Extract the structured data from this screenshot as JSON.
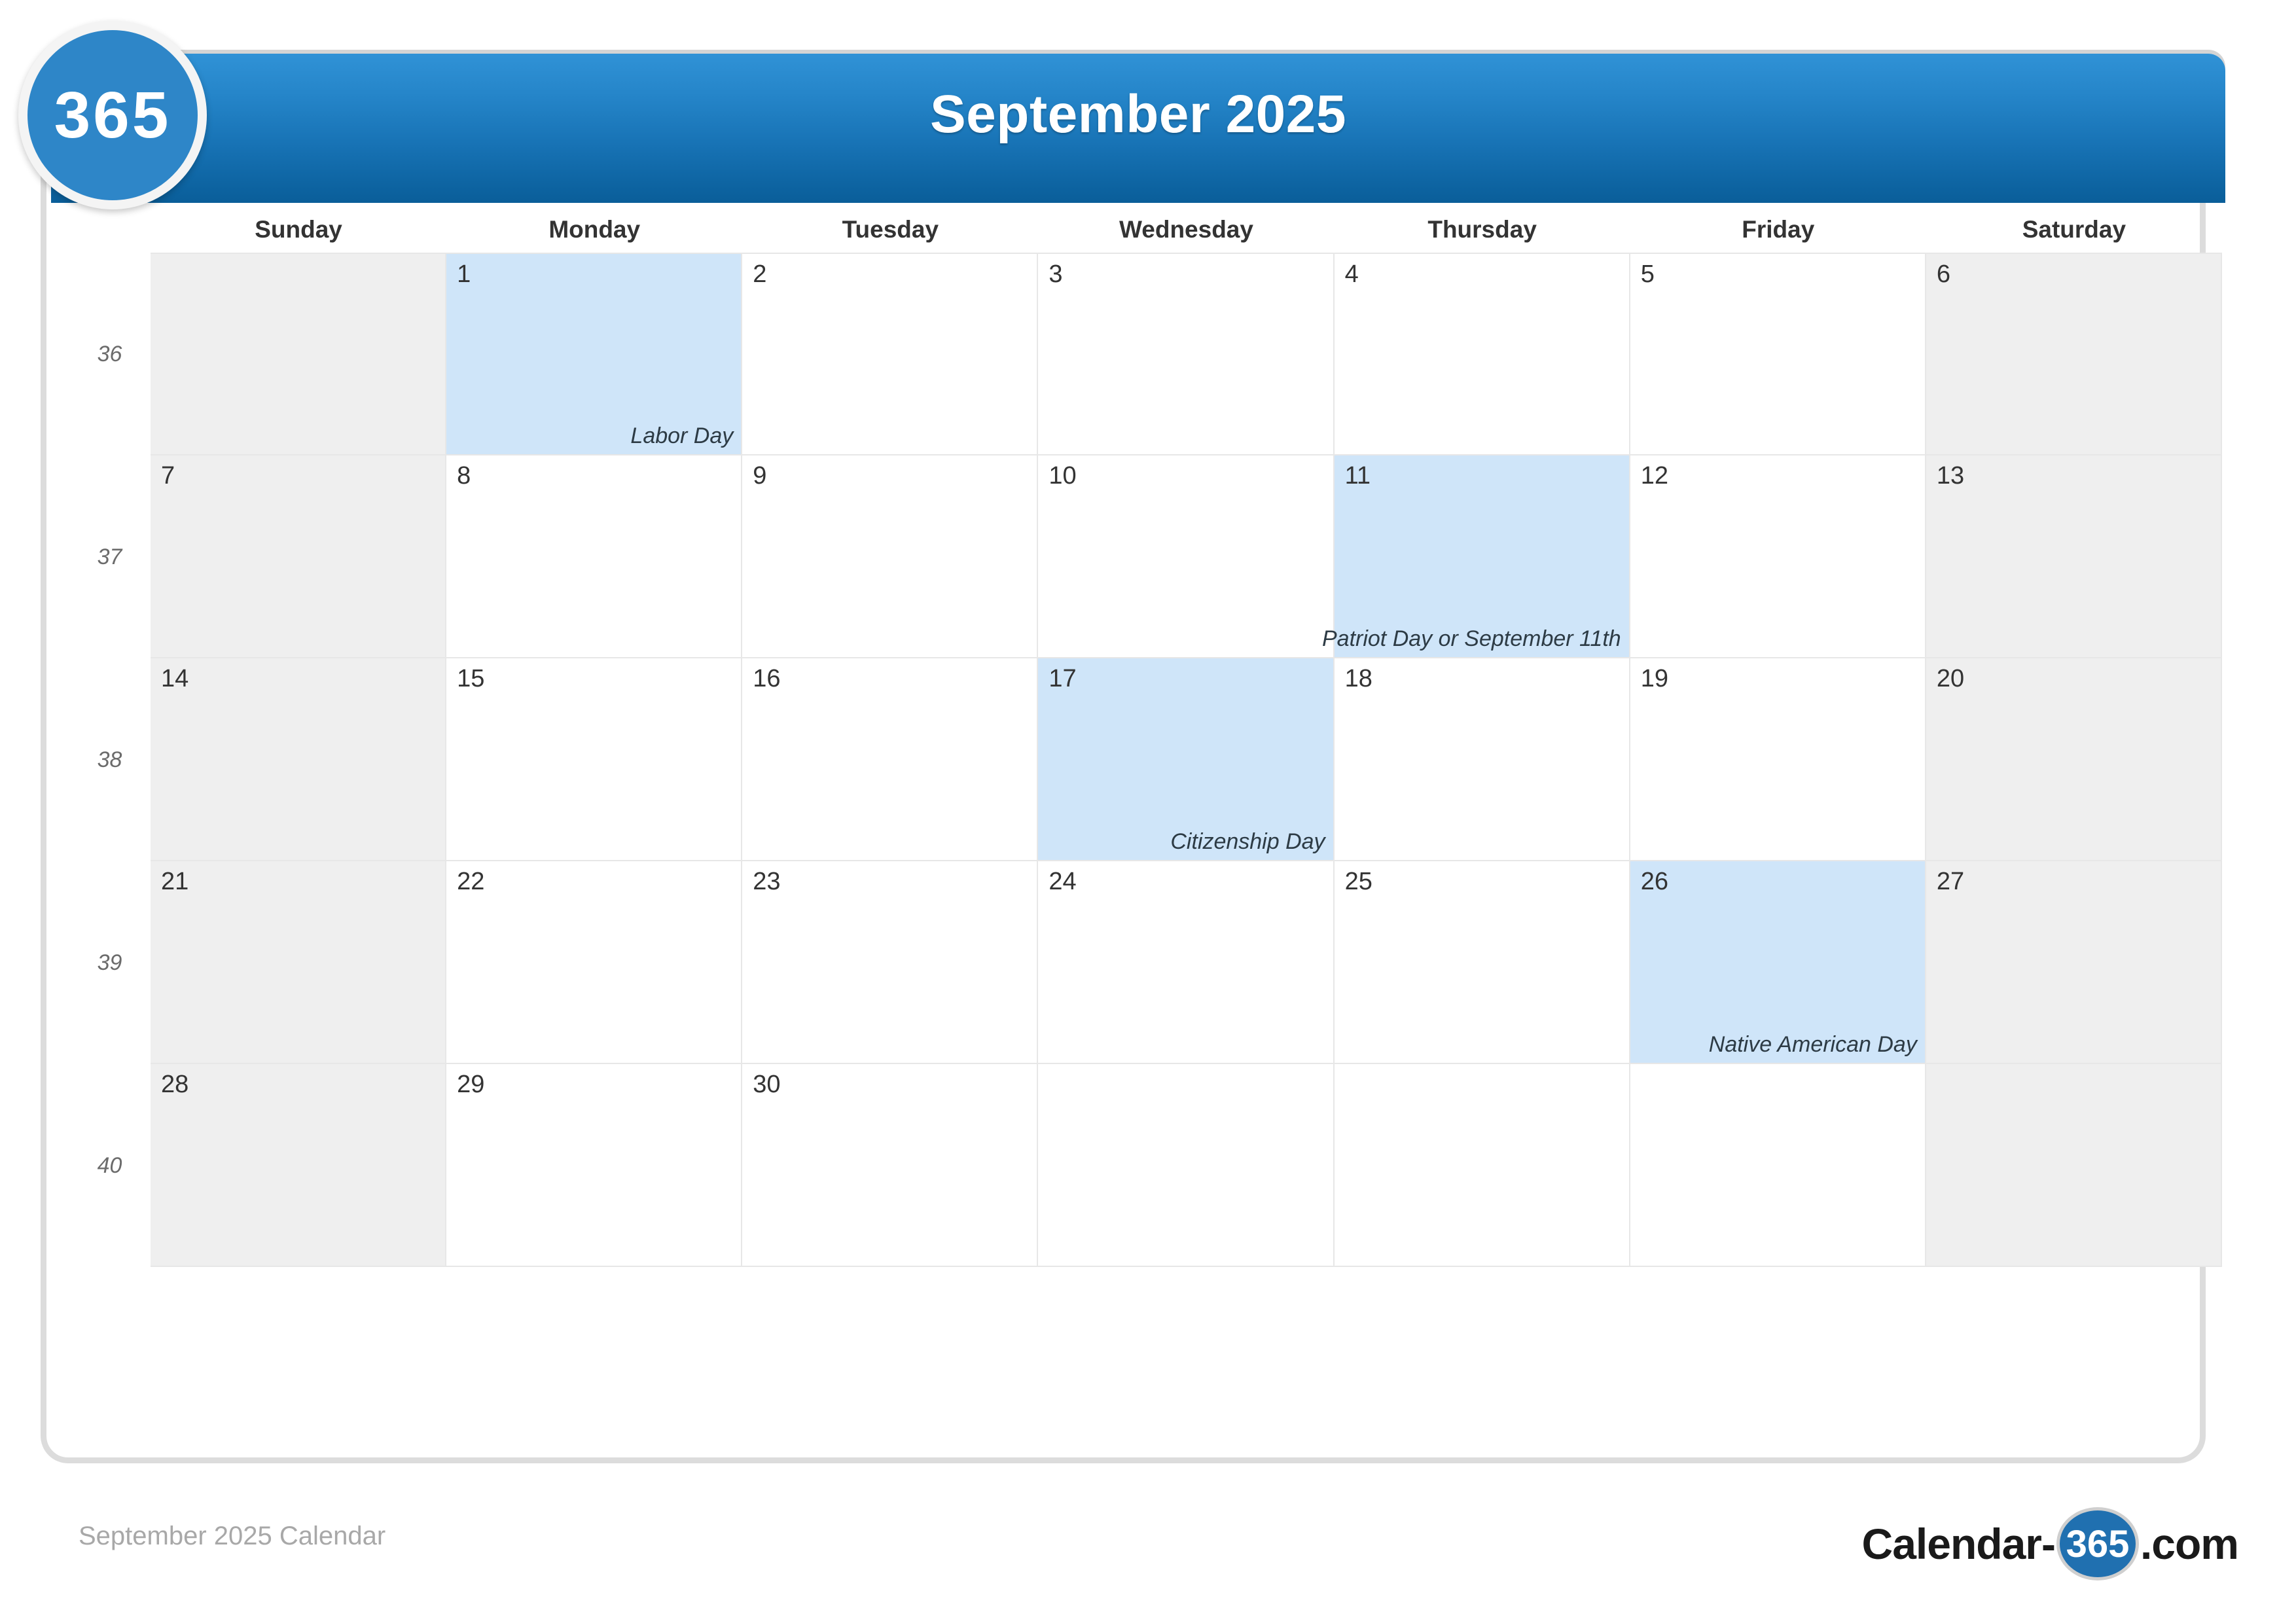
{
  "badge": {
    "label": "365"
  },
  "header": {
    "title": "September 2025"
  },
  "weekday_headers": [
    "Sunday",
    "Monday",
    "Tuesday",
    "Wednesday",
    "Thursday",
    "Friday",
    "Saturday"
  ],
  "watermark": {
    "text": "365"
  },
  "weeks": [
    {
      "week_number": "36",
      "days": [
        {
          "number": "",
          "event": "",
          "weekend": true,
          "holiday": false
        },
        {
          "number": "1",
          "event": "Labor Day",
          "weekend": false,
          "holiday": true
        },
        {
          "number": "2",
          "event": "",
          "weekend": false,
          "holiday": false
        },
        {
          "number": "3",
          "event": "",
          "weekend": false,
          "holiday": false
        },
        {
          "number": "4",
          "event": "",
          "weekend": false,
          "holiday": false
        },
        {
          "number": "5",
          "event": "",
          "weekend": false,
          "holiday": false
        },
        {
          "number": "6",
          "event": "",
          "weekend": true,
          "holiday": false
        }
      ]
    },
    {
      "week_number": "37",
      "days": [
        {
          "number": "7",
          "event": "",
          "weekend": true,
          "holiday": false
        },
        {
          "number": "8",
          "event": "",
          "weekend": false,
          "holiday": false
        },
        {
          "number": "9",
          "event": "",
          "weekend": false,
          "holiday": false
        },
        {
          "number": "10",
          "event": "",
          "weekend": false,
          "holiday": false
        },
        {
          "number": "11",
          "event": "Patriot Day or September 11th",
          "weekend": false,
          "holiday": true
        },
        {
          "number": "12",
          "event": "",
          "weekend": false,
          "holiday": false
        },
        {
          "number": "13",
          "event": "",
          "weekend": true,
          "holiday": false
        }
      ]
    },
    {
      "week_number": "38",
      "days": [
        {
          "number": "14",
          "event": "",
          "weekend": true,
          "holiday": false
        },
        {
          "number": "15",
          "event": "",
          "weekend": false,
          "holiday": false
        },
        {
          "number": "16",
          "event": "",
          "weekend": false,
          "holiday": false
        },
        {
          "number": "17",
          "event": "Citizenship Day",
          "weekend": false,
          "holiday": true
        },
        {
          "number": "18",
          "event": "",
          "weekend": false,
          "holiday": false
        },
        {
          "number": "19",
          "event": "",
          "weekend": false,
          "holiday": false
        },
        {
          "number": "20",
          "event": "",
          "weekend": true,
          "holiday": false
        }
      ]
    },
    {
      "week_number": "39",
      "days": [
        {
          "number": "21",
          "event": "",
          "weekend": true,
          "holiday": false
        },
        {
          "number": "22",
          "event": "",
          "weekend": false,
          "holiday": false
        },
        {
          "number": "23",
          "event": "",
          "weekend": false,
          "holiday": false
        },
        {
          "number": "24",
          "event": "",
          "weekend": false,
          "holiday": false
        },
        {
          "number": "25",
          "event": "",
          "weekend": false,
          "holiday": false
        },
        {
          "number": "26",
          "event": "Native American Day",
          "weekend": false,
          "holiday": true
        },
        {
          "number": "27",
          "event": "",
          "weekend": true,
          "holiday": false
        }
      ]
    },
    {
      "week_number": "40",
      "days": [
        {
          "number": "28",
          "event": "",
          "weekend": true,
          "holiday": false
        },
        {
          "number": "29",
          "event": "",
          "weekend": false,
          "holiday": false
        },
        {
          "number": "30",
          "event": "",
          "weekend": false,
          "holiday": false
        },
        {
          "number": "",
          "event": "",
          "weekend": false,
          "holiday": false
        },
        {
          "number": "",
          "event": "",
          "weekend": false,
          "holiday": false
        },
        {
          "number": "",
          "event": "",
          "weekend": false,
          "holiday": false
        },
        {
          "number": "",
          "event": "",
          "weekend": true,
          "holiday": false
        }
      ]
    }
  ],
  "footer": {
    "caption": "September 2025 Calendar",
    "logo_prefix": "Calendar-",
    "logo_badge": "365",
    "logo_suffix": ".com"
  },
  "colors": {
    "header_blue_top": "#3092d6",
    "header_blue_bottom": "#0a5e99",
    "holiday_fill": "#cfe5f9",
    "weekend_fill": "#efefef",
    "grid_line": "#e7e7e7",
    "frame_border": "#dcdcdc"
  }
}
